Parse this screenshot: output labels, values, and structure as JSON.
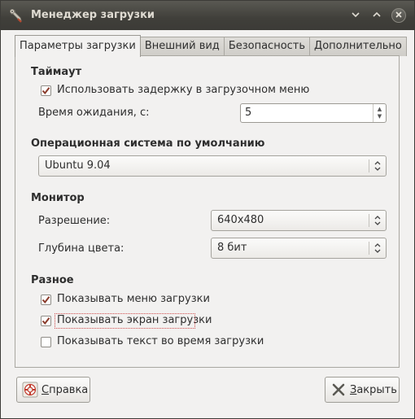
{
  "window": {
    "title": "Менеджер загрузки"
  },
  "tabs": [
    {
      "label": "Параметры загрузки",
      "active": true
    },
    {
      "label": "Внешний вид",
      "active": false
    },
    {
      "label": "Безопасность",
      "active": false
    },
    {
      "label": "Дополнительно",
      "active": false
    }
  ],
  "timeout": {
    "title": "Таймаут",
    "use_delay_label": "Использовать задержку в загрузочном меню",
    "use_delay_checked": true,
    "wait_label": "Время ожидания, с:",
    "wait_value": "5"
  },
  "default_os": {
    "title": "Операционная система по умолчанию",
    "value": "Ubuntu 9.04"
  },
  "monitor": {
    "title": "Монитор",
    "resolution_label": "Разрешение:",
    "resolution_value": "640x480",
    "depth_label": "Глубина цвета:",
    "depth_value": "8 бит"
  },
  "misc": {
    "title": "Разное",
    "show_menu_label": "Показывать меню загрузки",
    "show_menu_checked": true,
    "show_splash_label": "Показывать экран загрузки",
    "show_splash_checked": true,
    "show_text_label": "Показывать текст во время загрузки",
    "show_text_checked": false
  },
  "footer": {
    "help_label_first": "С",
    "help_label_rest": "правка",
    "close_label_first": "З",
    "close_label_rest": "акрыть"
  },
  "colors": {
    "titlebar": "#3c3b37",
    "checkmark": "#8a3a2a",
    "focus": "#d05050"
  }
}
